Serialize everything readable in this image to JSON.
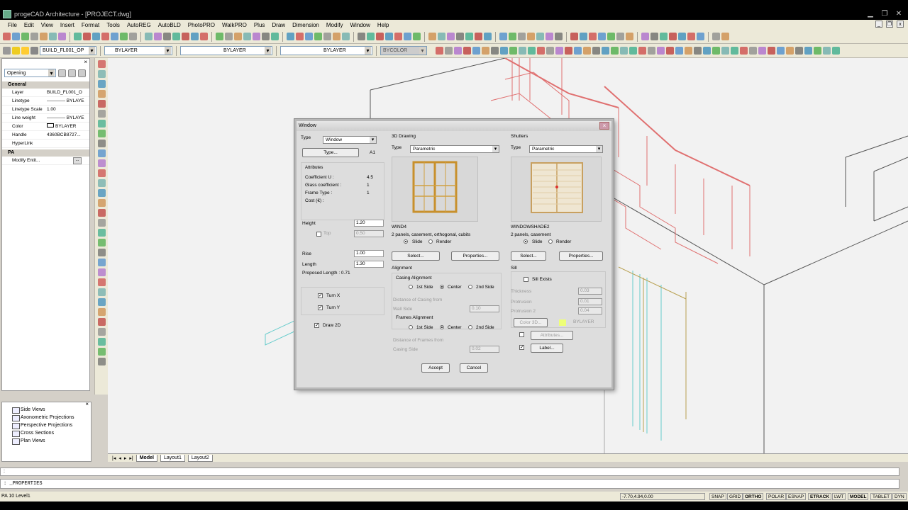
{
  "app": {
    "title": "progeCAD Architecture - [PROJECT.dwg]"
  },
  "menu": [
    "File",
    "Edit",
    "View",
    "Insert",
    "Format",
    "Tools",
    "AutoREG",
    "AutoBLD",
    "PhotoPRO",
    "WalkPRO",
    "Plus",
    "Draw",
    "Dimension",
    "Modify",
    "Window",
    "Help"
  ],
  "layer_toolbar": {
    "layer": "BUILD_FL001_OP",
    "color": "BYLAYER",
    "linetype": "BYLAYER",
    "lineweight": "BYLAYER",
    "plotstyle": "BYCOLOR"
  },
  "properties": {
    "selector": "Opening",
    "general_header": "General",
    "rows": [
      {
        "k": "Layer",
        "v": "BUILD_FL001_O"
      },
      {
        "k": "Linetype",
        "v": "———— BYLAYE"
      },
      {
        "k": "Linetype Scale",
        "v": "1.00"
      },
      {
        "k": "Line weight",
        "v": "———— BYLAYE"
      },
      {
        "k": "Color",
        "v": "BYLAYER"
      },
      {
        "k": "Handle",
        "v": "4360BCB8727..."
      },
      {
        "k": "HyperLink",
        "v": ""
      }
    ],
    "pa_header": "PA",
    "pa_rows": [
      {
        "k": "Modify Entit...",
        "v": ""
      }
    ]
  },
  "tree": [
    "Side Views",
    "Axonometric Projections",
    "Perspective Projections",
    "Cross Sections",
    "Plan Views"
  ],
  "tabs": [
    "Model",
    "Layout1",
    "Layout2"
  ],
  "command": {
    "line1": ":",
    "line2": ": _PROPERTIES"
  },
  "status": {
    "left": "PA 10 Level1",
    "coords": "-7.70,4.94,0.00",
    "toggles": [
      "SNAP",
      "GRID",
      "ORTHO",
      "POLAR",
      "ESNAP",
      "ETRACK",
      "LWT",
      "MODEL",
      "TABLET",
      "DYN"
    ]
  },
  "dialog": {
    "title": "Window",
    "type_label": "Type",
    "type_value": "Window",
    "type_button": "Type...",
    "type_code": "A1",
    "attributes_label": "Attributes",
    "attributes": [
      {
        "k": "Coefficient U :",
        "v": "4.5"
      },
      {
        "k": "Glass coefficient :",
        "v": "1"
      },
      {
        "k": "Frame Type :",
        "v": "1"
      },
      {
        "k": "Cost (€) :",
        "v": ""
      }
    ],
    "height_label": "Height",
    "height_value": "1.20",
    "top_label": "Top",
    "top_value": "0.50",
    "rise_label": "Rise",
    "rise_value": "1.00",
    "length_label": "Length",
    "length_value": "1.30",
    "proposed_length": "Proposed Length : 0.71",
    "turn_x": "Turn X",
    "turn_y": "Turn Y",
    "draw_2d": "Draw 2D",
    "drawing3d": {
      "title": "3D Drawing",
      "type_label": "Type",
      "type_value": "Parametric",
      "name": "WIND4",
      "desc": "2 panels, casement, orthogonal, cubits",
      "slide": "Slide",
      "render": "Render",
      "select": "Select...",
      "properties": "Properties..."
    },
    "shutters": {
      "title": "Shutters",
      "type_label": "Type",
      "type_value": "Parametric",
      "name": "WINDOWSHADE2",
      "desc": "2 panels, casement",
      "slide": "Slide",
      "render": "Render",
      "select": "Select...",
      "properties": "Properties..."
    },
    "alignment": {
      "title": "Alignment",
      "casing_title": "Casing Alignment",
      "opt1": "1st Side",
      "opt2": "Center",
      "opt3": "2nd Side",
      "casing_dist_label": "Distance of Casing from",
      "wall_side_label": "Wall Side",
      "wall_side_value": "0.10",
      "frames_title": "Frames Alignment",
      "frames_dist_label": "Distance of Frames from",
      "casing_side_label": "Casing Side",
      "casing_side_value": "0.02"
    },
    "sill": {
      "title": "Sill",
      "exists": "Sill Exists",
      "thickness_label": "Thickness",
      "thickness_value": "0.03",
      "protrusion_label": "Protrusion",
      "protrusion_value": "0.01",
      "protrusion2_label": "Protrusion 2",
      "protrusion2_value": "0.04",
      "color_btn": "Color 3D...",
      "color_value": "BYLAYER",
      "attributes_btn": "Attributes...",
      "label_btn": "Label..."
    },
    "accept": "Accept",
    "cancel": "Cancel"
  }
}
